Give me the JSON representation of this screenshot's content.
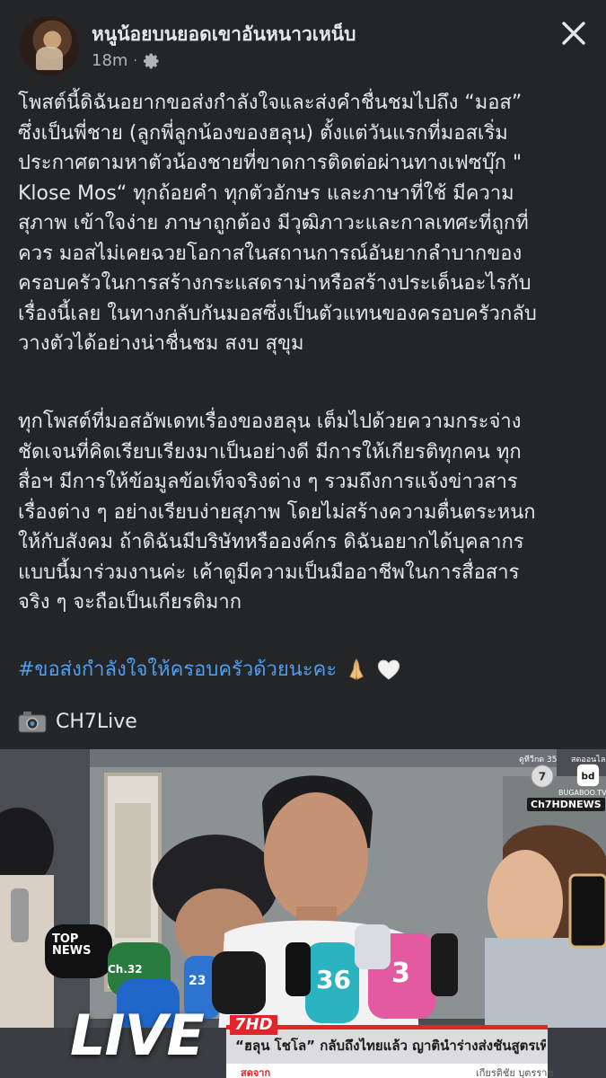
{
  "post": {
    "author": "หนูน้อยบนยอดเขาอันหนาวเหน็บ",
    "time": "18m",
    "separator": "·",
    "paragraph1": "โพสต์นี้ดิฉันอยากขอส่งกำลังใจและส่งคำชื่นชมไปถึง “มอส”\nซึ่งเป็นพี่ชาย (ลูกพี่ลูกน้องของฮลุน) ตั้งแต่วันแรกที่มอสเริ่ม\nประกาศตามหาตัวน้องชายที่ขาดการติดต่อผ่านทางเฟซบุ๊ก \"\nKlose Mos“ ทุกถ้อยคำ ทุกตัวอักษร และภาษาที่ใช้ มีความ\nสุภาพ เข้าใจง่าย ภาษาถูกต้อง มีวุฒิภาวะและกาลเทศะที่ถูกที่\nควร มอสไม่เคยฉวยโอกาสในสถานการณ์อันยากลำบากของ\nครอบครัวในการสร้างกระแสดราม่าหรือสร้างประเด็นอะไรกับ\nเรื่องนี้เลย ในทางกลับกันมอสซึ่งเป็นตัวแทนของครอบครัวกลับ\nวางตัวได้อย่างน่าชื่นชม สงบ สุขุม",
    "paragraph2": "ทุกโพสต์ที่มอสอัพเดทเรื่องของฮลุน เต็มไปด้วยความกระจ่าง\nชัดเจนที่คิดเรียบเรียงมาเป็นอย่างดี มีการให้เกียรติทุกคน ทุก\nสื่อฯ มีการให้ข้อมูลข้อเท็จจริงต่าง ๆ รวมถึงการแจ้งข่าวสาร\nเรื่องต่าง ๆ อย่างเรียบง่ายสุภาพ โดยไม่สร้างความตื่นตระหนก\nให้กับสังคม ถ้าดิฉันมีบริษัทหรือองค์กร ดิฉันอยากได้บุคลากร\nแบบนี้มาร่วมงานค่ะ เค้าดูมีความเป็นมืออาชีพในการสื่อสาร\nจริง ๆ จะถือเป็นเกียรติมาก",
    "hashtag": "#ขอส่งกำลังใจให้ครอบครัวด้วยนะคะ",
    "credit": "CH7Live"
  },
  "photo": {
    "channel_top_left": "ดูทีวีกด 35",
    "channel_top_right": "สดออนไลน์",
    "bugaboo": "BUGABOO.TV",
    "ch7hd_news": "Ch7HDNEWS",
    "live_label": "LIVE",
    "hd_badge": "7HD",
    "headline": "“ฮลุน โชโล” กลับถึงไทยแล้ว ญาตินำร่างส่งชันสูตรเพิ่ม",
    "sub_left": "สดจาก",
    "sub_right": "เกียรติชัย บุตรราช",
    "mic_labels": [
      "TOP NEWS",
      "Ch.32",
      "23",
      "36",
      "3"
    ]
  },
  "icons": {
    "settings": "gear-icon",
    "close": "close-icon",
    "camera": "camera-emoji-icon",
    "pray": "pray-emoji-icon",
    "heart": "white-heart-emoji-icon"
  },
  "colors": {
    "background": "#242526",
    "text": "#e4e6eb",
    "secondary": "#b0b3b8",
    "link": "#4f9ef2",
    "news_red": "#e3242b"
  }
}
